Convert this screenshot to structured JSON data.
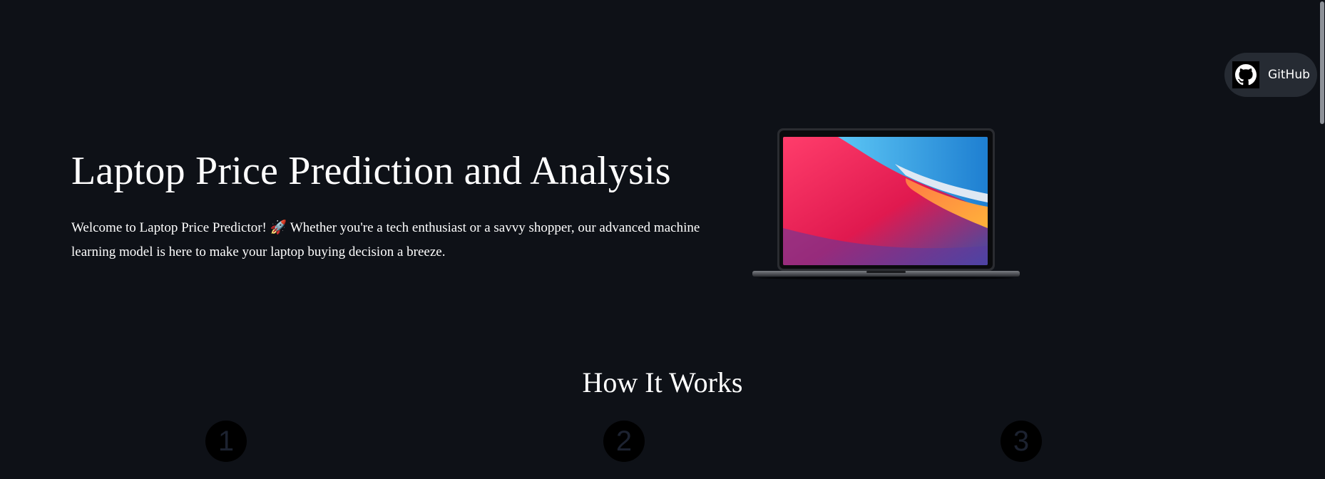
{
  "hero": {
    "title": "Laptop Price Prediction and Analysis",
    "desc_part1": "Welcome to Laptop Price Predictor! ",
    "desc_emoji": "🚀",
    "desc_part2": " Whether you're a tech enthusiast or a savvy shopper, our advanced machine learning model is here to make your laptop buying decision a breeze."
  },
  "how_it_works": {
    "title": "How It Works",
    "steps": [
      "1",
      "2",
      "3"
    ]
  },
  "github": {
    "label": "GitHub",
    "icon": "github-icon"
  },
  "colors": {
    "background": "#0e1117",
    "button_bg": "#262b33",
    "text": "#ffffff"
  }
}
